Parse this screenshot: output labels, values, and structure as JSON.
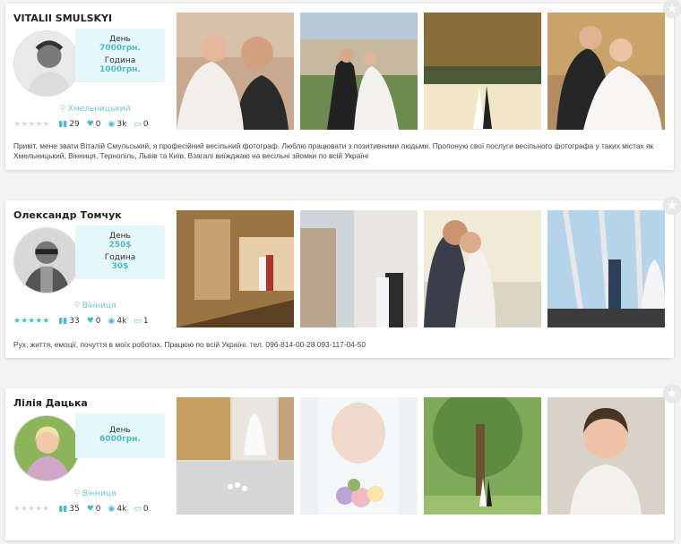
{
  "cards": [
    {
      "name": "VITALII SMULSKYI",
      "prices": [
        {
          "label": "День",
          "value": "7000грн."
        },
        {
          "label": "Година",
          "value": "1000грн."
        }
      ],
      "city": "Хмельницький",
      "rating_stars": 0,
      "stats": {
        "photos": "29",
        "likes": "0",
        "views": "3k",
        "comments": "0"
      },
      "description": "Привіт, мене звати Віталій Смульський, я професійний весільний фотограф. Люблю працювати з позитивними людьми. Пропоную свої послуги весільного фотографа у таких містах як Хмельницький, Вінниця, Тернопіль, Львів та Київ. Взагалі виїжджаю на весільні зйомки по всій Україні"
    },
    {
      "name": "Олександр Томчук",
      "prices": [
        {
          "label": "День",
          "value": "250$"
        },
        {
          "label": "Година",
          "value": "30$"
        }
      ],
      "city": "Вінниця",
      "rating_stars": 5,
      "stats": {
        "photos": "33",
        "likes": "0",
        "views": "4k",
        "comments": "1"
      },
      "description": "Рух, життя, емоції, почуття в моїх роботах. Працюю по всій Україні. тел. 096-814-00-28 093-117-04-50"
    },
    {
      "name": "Лілія Дацька",
      "prices": [
        {
          "label": "День",
          "value": "6000грн."
        }
      ],
      "city": "Вінниця",
      "rating_stars": 0,
      "stats": {
        "photos": "35",
        "likes": "0",
        "views": "4k",
        "comments": "0"
      },
      "description": ""
    }
  ],
  "icons": {
    "favorite": "star-icon",
    "location": "map-pin-icon",
    "photos": "bar-chart-icon",
    "likes": "heart-icon",
    "views": "eye-icon",
    "comments": "comment-icon"
  },
  "colors": {
    "accent": "#4dbcc8",
    "price_bg": "#e5f7fa",
    "inactive_star": "#d9d9d9"
  }
}
